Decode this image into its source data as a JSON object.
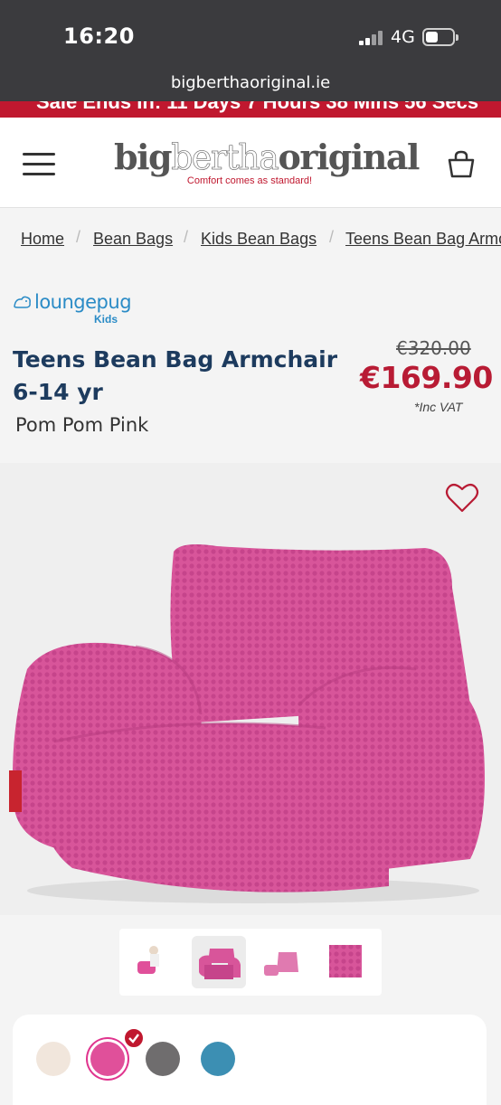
{
  "status_bar": {
    "time": "16:20",
    "network": "4G"
  },
  "browser": {
    "url": "bigberthaoriginal.ie"
  },
  "sale_banner": {
    "text": "Sale Ends In: 11 Days  7 Hours  38 Mins  56 Secs",
    "color": "#c0182f"
  },
  "header": {
    "logo_part1": "big",
    "logo_part2": "bertha",
    "logo_part3": "original",
    "tagline": "Comfort comes as standard!"
  },
  "breadcrumb": {
    "items": [
      "Home",
      "Bean Bags",
      "Kids Bean Bags",
      "Teens Bean Bag Armchair"
    ],
    "separator": "/"
  },
  "product": {
    "brand_name": "loungepug",
    "brand_sub": "Kids",
    "title": "Teens Bean Bag Armchair 6-14 yr",
    "variant": "Pom Pom Pink",
    "price_old": "€320.00",
    "price_new": "€169.90",
    "vat_note": "*Inc VAT",
    "price_color": "#b81b34",
    "title_color": "#1d3b5e"
  },
  "gallery": {
    "icons": [
      "heart-icon"
    ],
    "thumbnails": [
      "child-seated-thumb",
      "armchair-front-thumb",
      "armchair-footstool-thumb",
      "fabric-closeup-thumb"
    ],
    "selected_thumbnail": 1
  },
  "swatches": {
    "colors": [
      "#f1e6dc",
      "#e0509a",
      "#6f6d6e",
      "#3c8fb3"
    ],
    "selected": 1
  }
}
